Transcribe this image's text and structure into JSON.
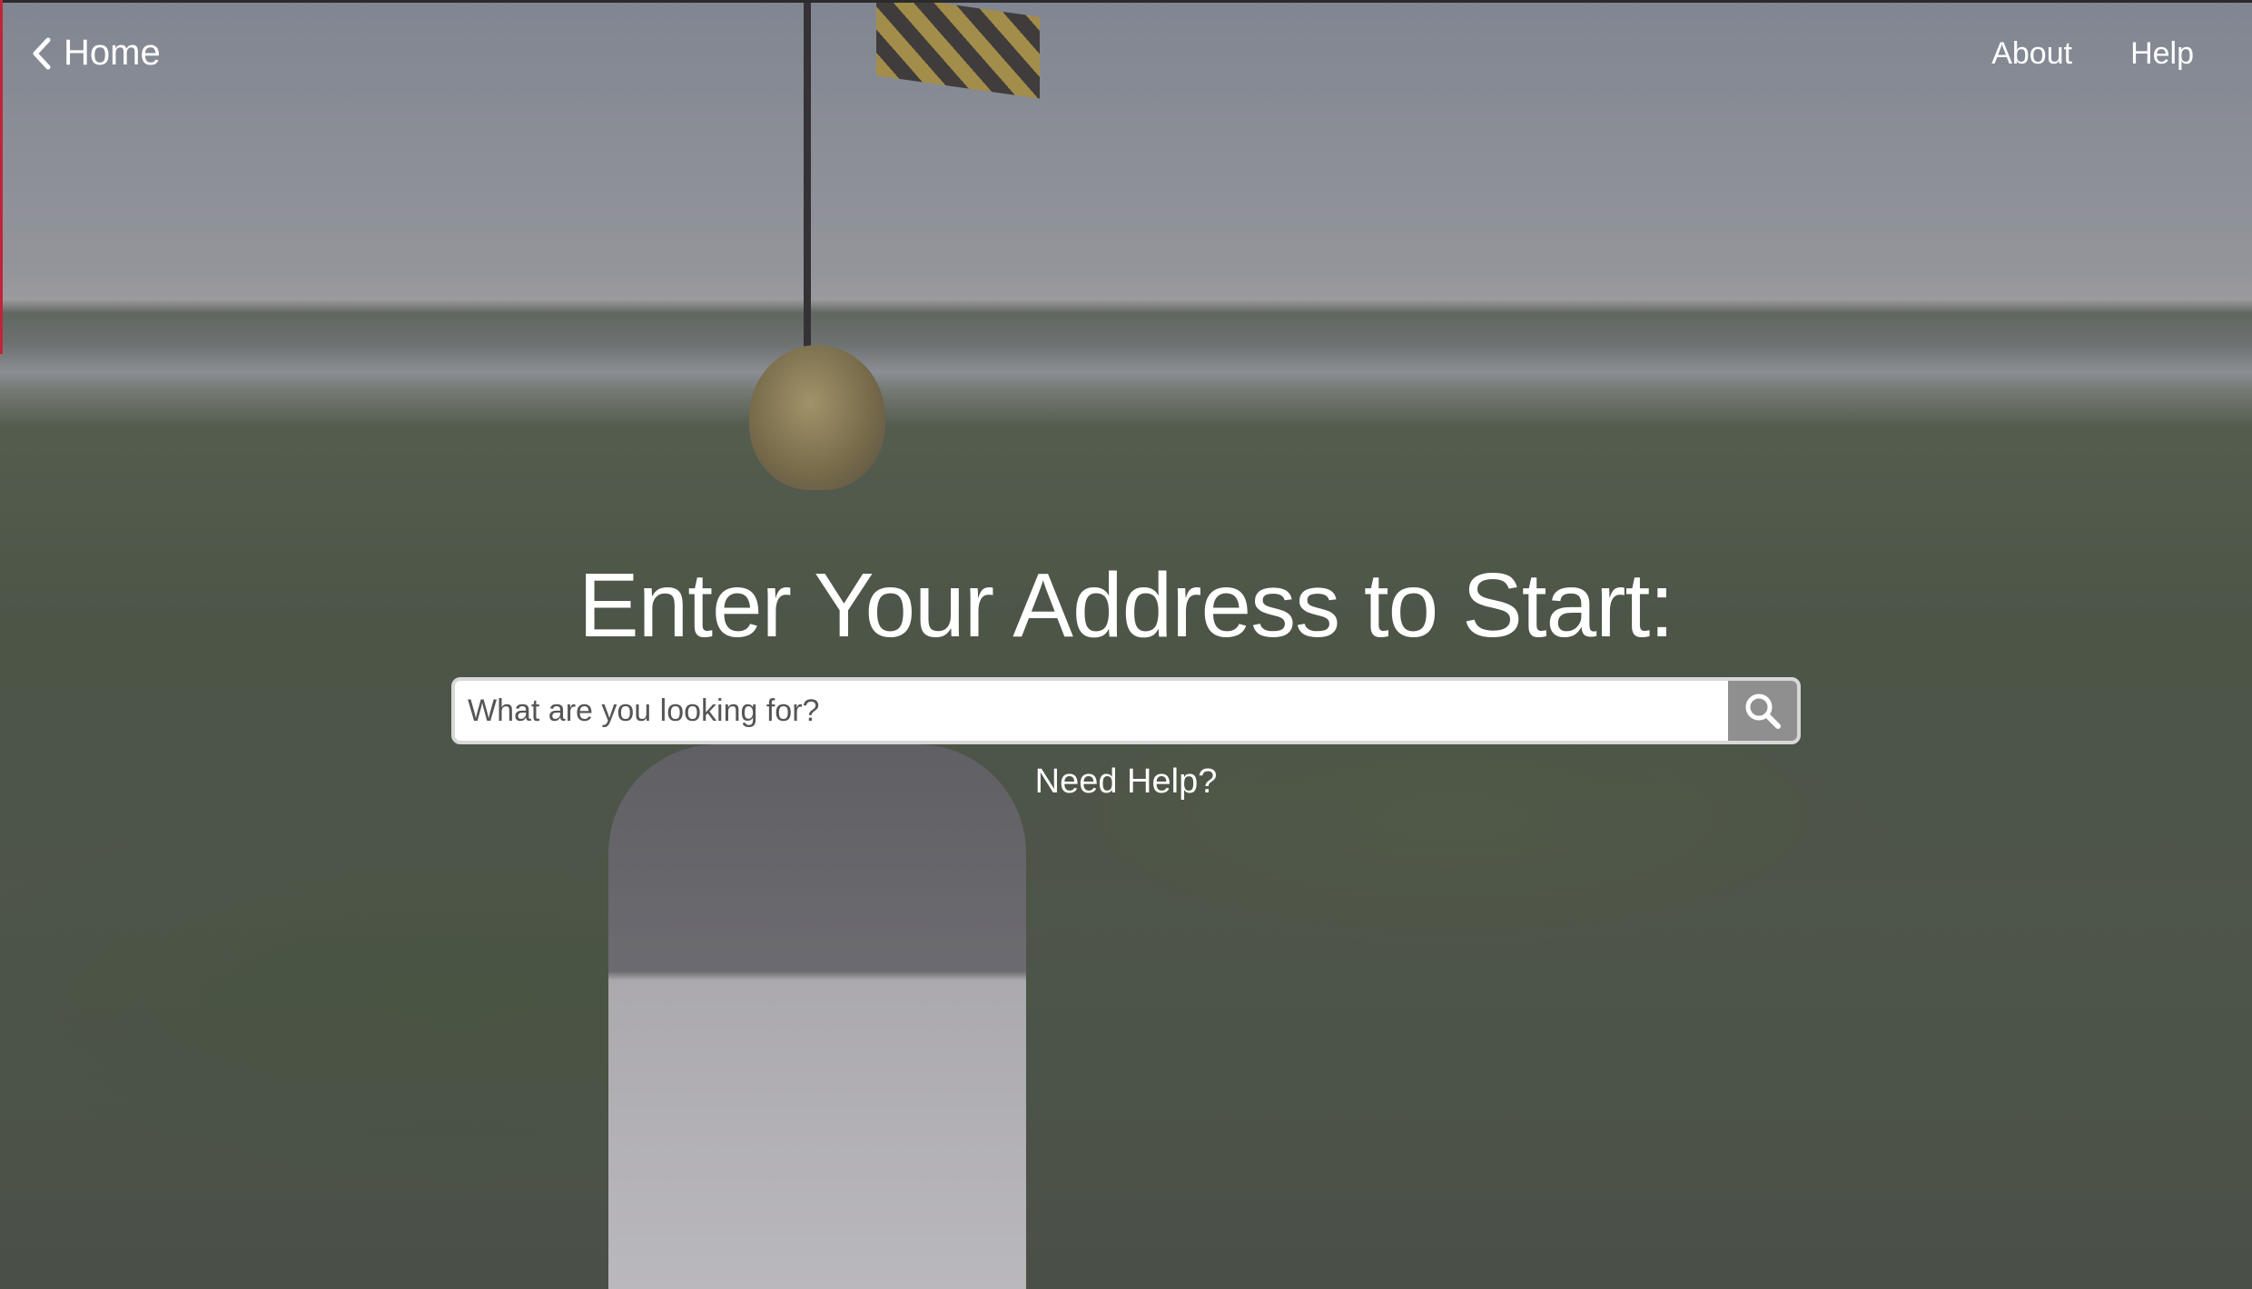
{
  "nav": {
    "home_label": "Home",
    "about_label": "About",
    "help_label": "Help"
  },
  "main": {
    "headline": "Enter Your Address to Start:",
    "search": {
      "placeholder": "What are you looking for?",
      "value": ""
    },
    "need_help_label": "Need Help?"
  },
  "icons": {
    "back": "chevron-left-icon",
    "search": "search-icon"
  },
  "colors": {
    "text": "#ffffff",
    "search_button": "#8f8f8f",
    "accent_bar": "#c0243a"
  }
}
